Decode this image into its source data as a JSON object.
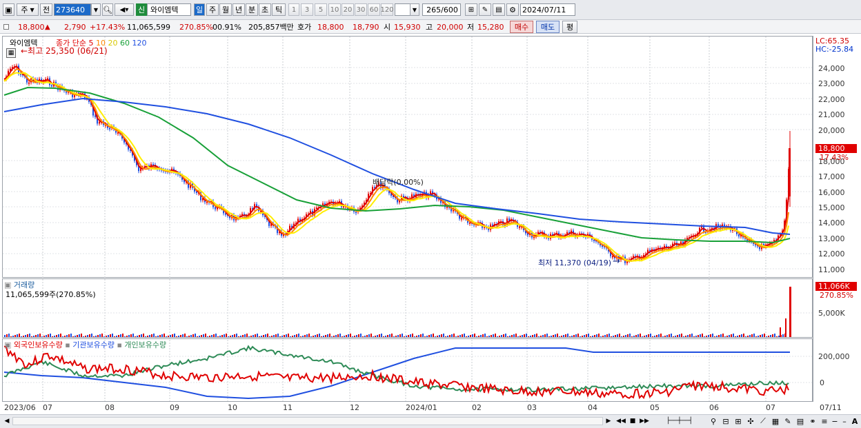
{
  "toolbar": {
    "market_type": "주",
    "prev_label": "전",
    "code": "273640",
    "new_badge": "신",
    "stock_name": "와이엠텍",
    "period_day": "일",
    "period_week": "주",
    "period_month": "월",
    "period_year": "년",
    "period_min": "분",
    "period_sec": "초",
    "period_tick": "틱",
    "intervals": [
      "1",
      "3",
      "5",
      "10",
      "20",
      "30",
      "60",
      "120"
    ],
    "count": "265",
    "total": "/600",
    "date": "2024/07/11"
  },
  "quote": {
    "price": "18,800",
    "change_arrow": "▲",
    "change": "2,790",
    "change_pct": "+17.43%",
    "volume": "11,065,599",
    "volume_ratio": "270.85%",
    "turnover": "00.91%",
    "amount": "205,857백만",
    "ask_label": "호가",
    "ask": "18,800",
    "bid": "18,790",
    "open_label": "시",
    "open": "15,930",
    "high_label": "고",
    "high": "20,000",
    "low_label": "저",
    "low": "15,280",
    "buy_button": "매수",
    "sell_button": "매도",
    "eval_button": "평"
  },
  "price_pane": {
    "stock_label": "와이엠텍",
    "ma_label": "종가 단순",
    "ma_periods": [
      "5",
      "10",
      "20",
      "60",
      "120"
    ],
    "ma_colors": [
      "#e00000",
      "#ff8800",
      "#ffee00",
      "#18a038",
      "#1f4fe0"
    ],
    "high_note": "←최고 25,350 (06/21)",
    "low_note": "최저 11,370 (04/19)",
    "low_arrow": "→",
    "dividend_note": "배당락(0.00%)",
    "lc_label": "LC:65.35",
    "hc_label": "HC:-25.84",
    "y_ticks": [
      "24,000",
      "23,000",
      "22,000",
      "21,000",
      "20,000",
      "18,000",
      "17,000",
      "16,000",
      "15,000",
      "14,000",
      "13,000",
      "12,000",
      "11,000"
    ],
    "price_tag": "18,800",
    "pct_tag": "17.43%"
  },
  "volume_pane": {
    "title": "거래량",
    "readout": "11,065,599주(270.85%)",
    "tag": "11,066K",
    "pct_tag": "270.85%",
    "y_tick": "5,000K"
  },
  "holdings_pane": {
    "foreign_label": "외국인보유수량",
    "inst_label": "기관보유수량",
    "indiv_label": "개인보유수량",
    "colors": {
      "foreign": "#e00000",
      "institution": "#1f4fe0",
      "individual": "#2e8b57"
    },
    "y_ticks": [
      "200,000",
      "0"
    ]
  },
  "x_axis": [
    "2023/06",
    "07",
    "08",
    "09",
    "10",
    "11",
    "12",
    "2024/01",
    "02",
    "03",
    "04",
    "05",
    "06",
    "07",
    "07/11"
  ],
  "colors": {
    "up": "#e00000",
    "down": "#1f4fe0",
    "selected": "#1b6ac9"
  }
}
